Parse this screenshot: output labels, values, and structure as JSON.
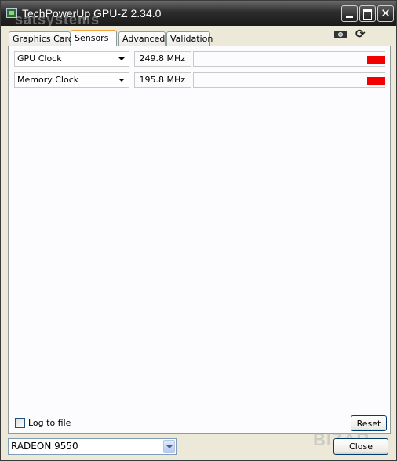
{
  "window": {
    "title": "TechPowerUp GPU-Z 2.34.0",
    "overlay_watermark": "satsystems"
  },
  "tabs": [
    {
      "label": "Graphics Card",
      "active": false
    },
    {
      "label": "Sensors",
      "active": true
    },
    {
      "label": "Advanced",
      "active": false
    },
    {
      "label": "Validation",
      "active": false
    }
  ],
  "toolbar": {
    "camera_icon": "camera-icon",
    "refresh_icon": "refresh-icon"
  },
  "sensors": [
    {
      "name": "GPU Clock",
      "value": "249.8 MHz"
    },
    {
      "name": "Memory Clock",
      "value": "195.8 MHz"
    }
  ],
  "footer": {
    "log_label": "Log to file",
    "log_checked": false,
    "reset_label": "Reset",
    "gpu_selected": "RADEON 9550",
    "close_label": "Close",
    "watermark": "BIZAR"
  },
  "colors": {
    "graph_bar": "#f20000",
    "active_tab_accent": "#f3a23a"
  }
}
